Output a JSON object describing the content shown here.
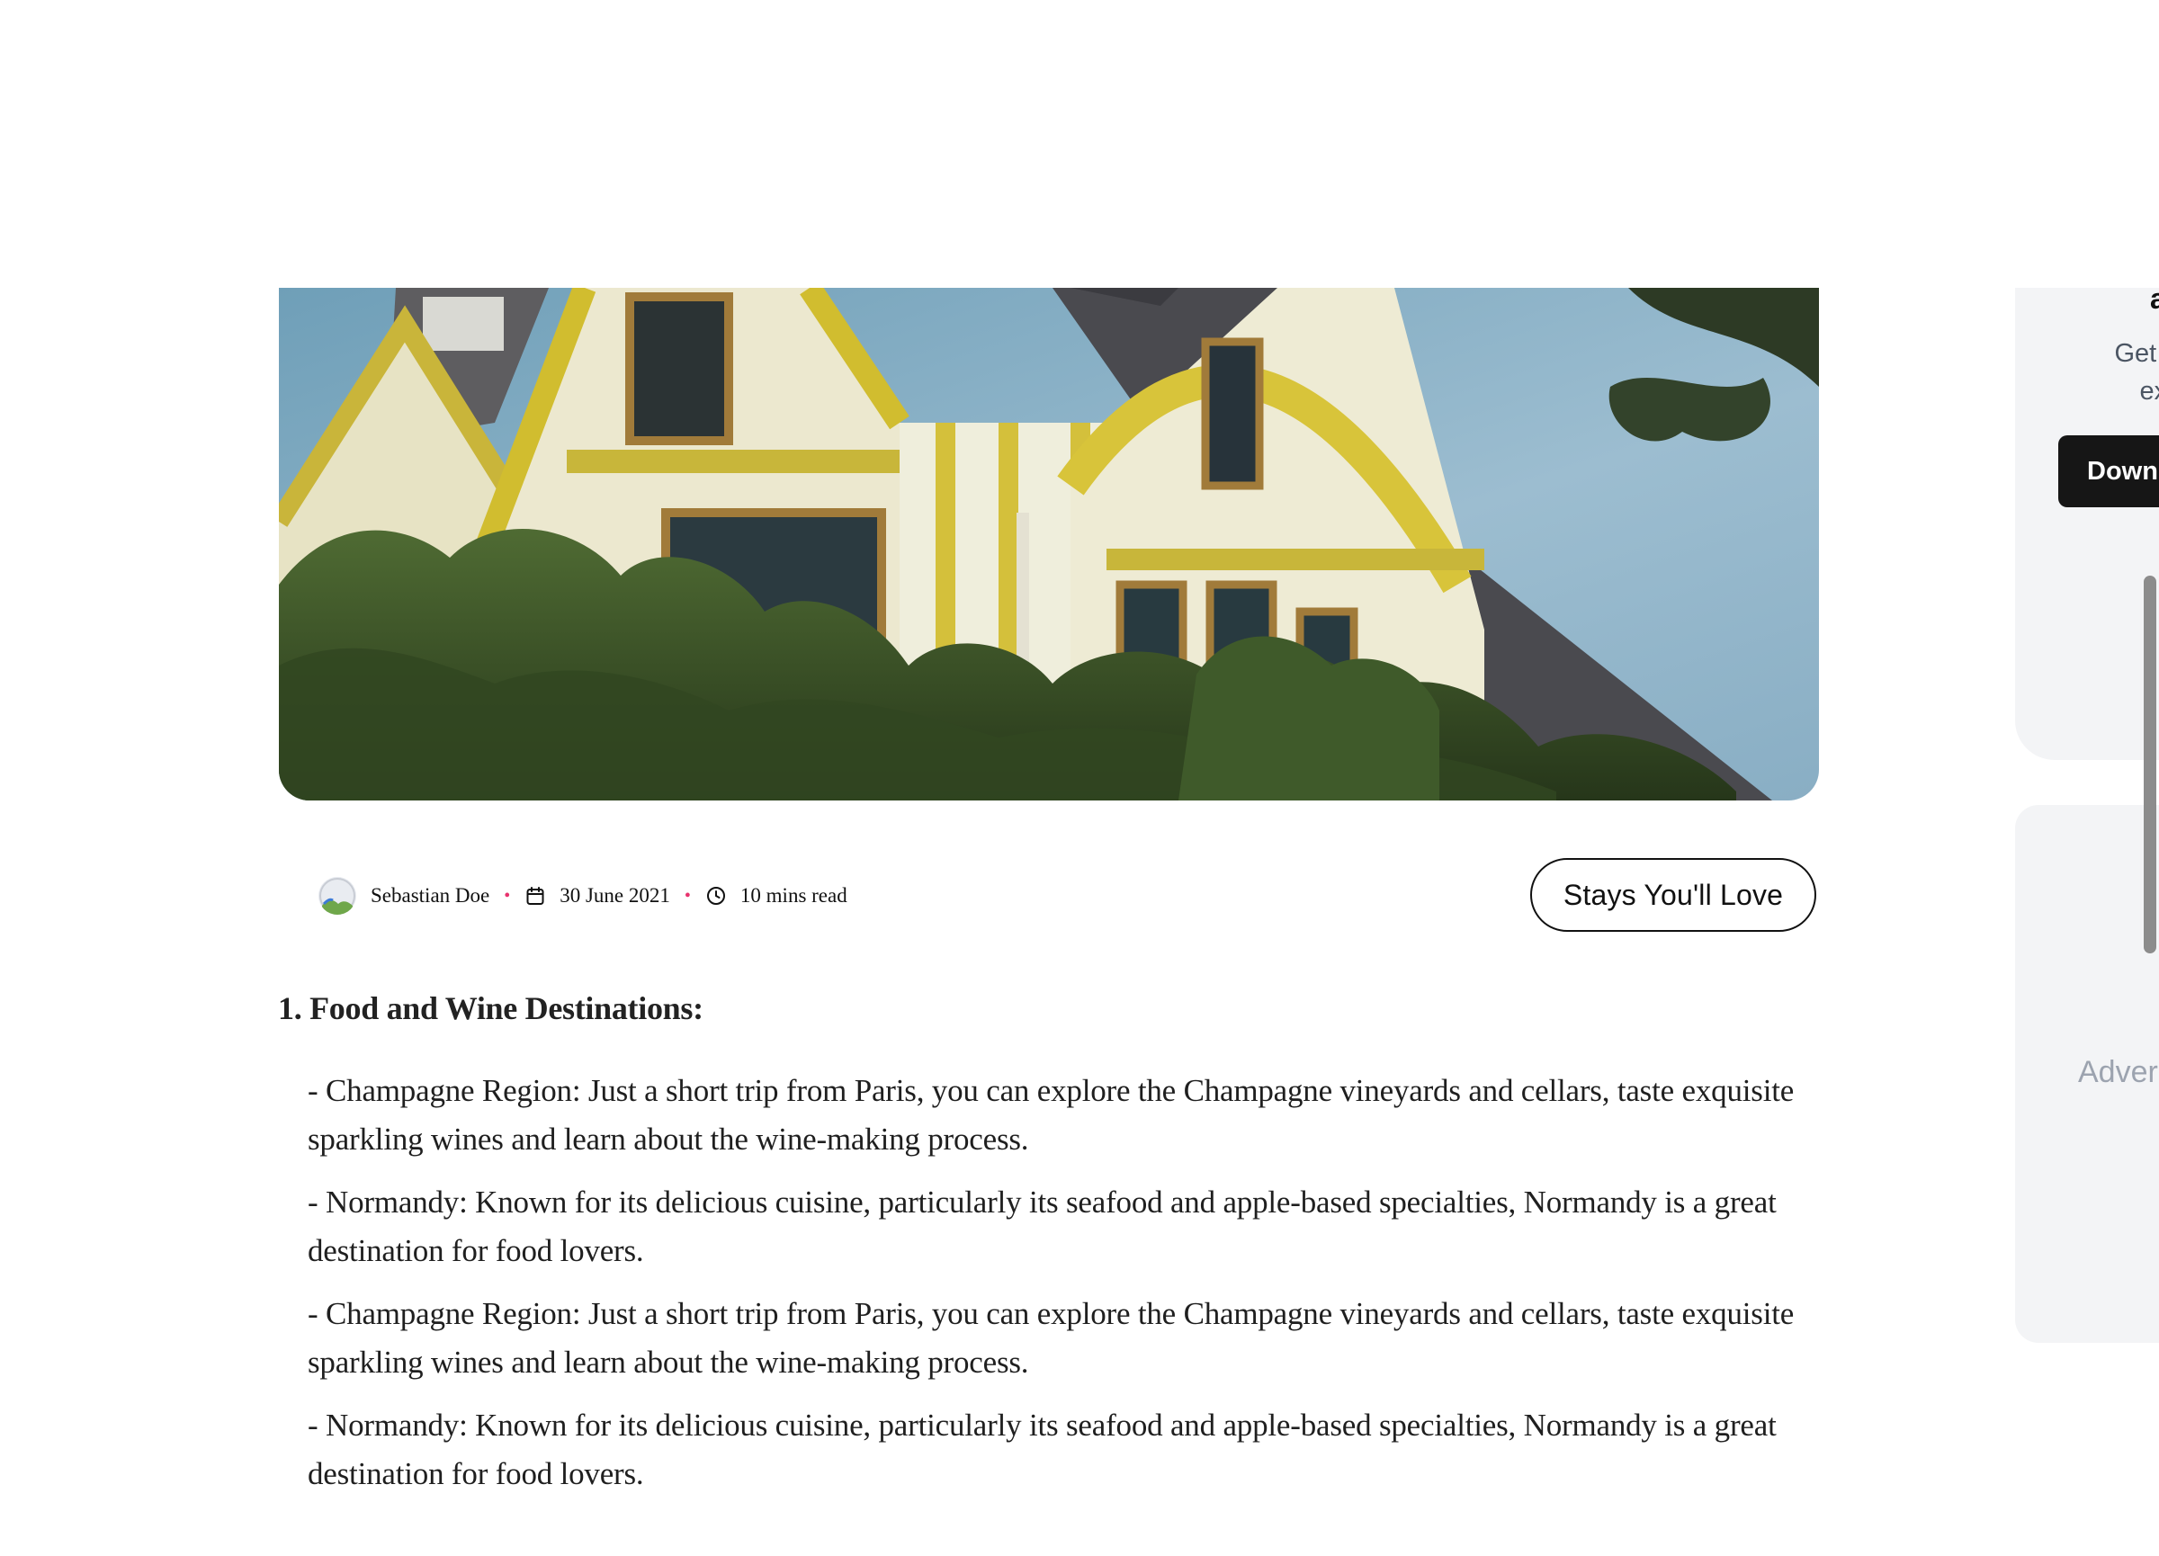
{
  "article": {
    "author": "Sebastian Doe",
    "date": "30 June 2021",
    "read_time": "10 mins read",
    "category_button": "Stays You'll Love",
    "section_heading": "1. Food and Wine Destinations:",
    "paragraphs": [
      "- Champagne Region: Just a short trip from Paris, you can explore the Champagne vineyards and cellars, taste exquisite sparkling wines and learn about the wine-making process.",
      "- Normandy: Known for its delicious cuisine, particularly its seafood and apple-based specialties, Normandy is a great destination for food lovers.",
      "- Champagne Region: Just a short trip from Paris, you can explore the Champagne vineyards and cellars, taste exquisite sparkling wines and learn about the wine-making process.",
      "- Normandy: Known for its delicious cuisine, particularly its seafood and apple-based specialties, Normandy is a great destination for food lovers."
    ],
    "icons": {
      "date": "calendar-icon",
      "read_time": "clock-icon"
    },
    "accent_color": "#e8336e"
  },
  "sidebar": {
    "download_card": {
      "heading_fragment": "a",
      "desc_line1": "Get the",
      "desc_line2": "expe",
      "button_label": "Downl"
    },
    "ad_card": {
      "label": "Adver"
    }
  }
}
